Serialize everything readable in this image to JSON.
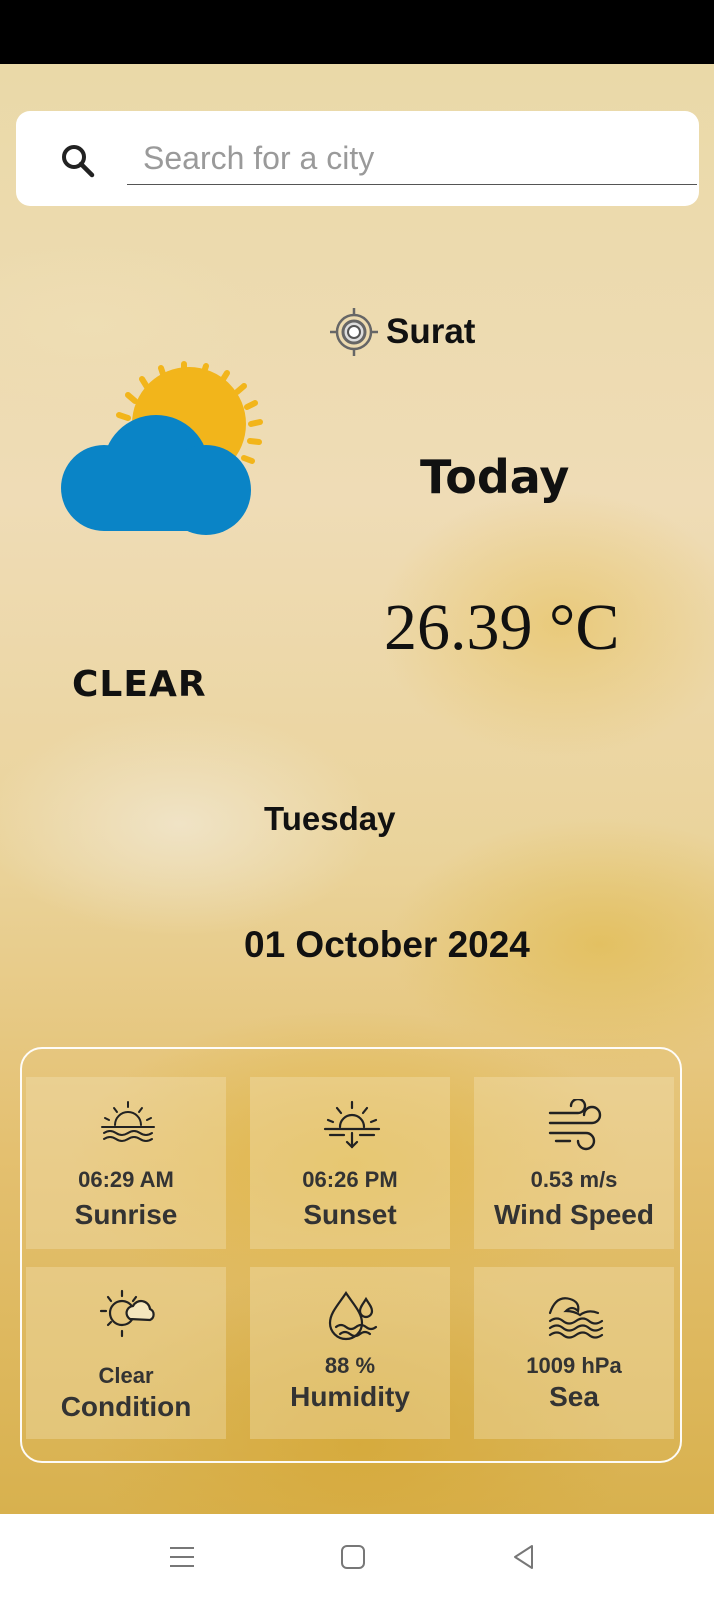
{
  "search": {
    "placeholder": "Search for a city",
    "value": ""
  },
  "location": {
    "city": "Surat"
  },
  "current": {
    "heading": "Today",
    "temperature": "26.39 °C",
    "condition": "CLEAR",
    "day": "Tuesday",
    "date": "01 October 2024"
  },
  "details": [
    {
      "icon": "sunrise-icon",
      "value": "06:29 AM",
      "label": "Sunrise"
    },
    {
      "icon": "sunset-icon",
      "value": "06:26 PM",
      "label": "Sunset"
    },
    {
      "icon": "wind-icon",
      "value": "0.53 m/s",
      "label": "Wind Speed"
    },
    {
      "icon": "cloudy-sun-icon",
      "value": "Clear",
      "label": "Condition"
    },
    {
      "icon": "humidity-icon",
      "value": "88 %",
      "label": "Humidity"
    },
    {
      "icon": "sea-waves-icon",
      "value": "1009 hPa",
      "label": "Sea"
    }
  ],
  "colors": {
    "sun": "#f2b51b",
    "cloud": "#0a84c6",
    "card_border": "#ffffff"
  }
}
